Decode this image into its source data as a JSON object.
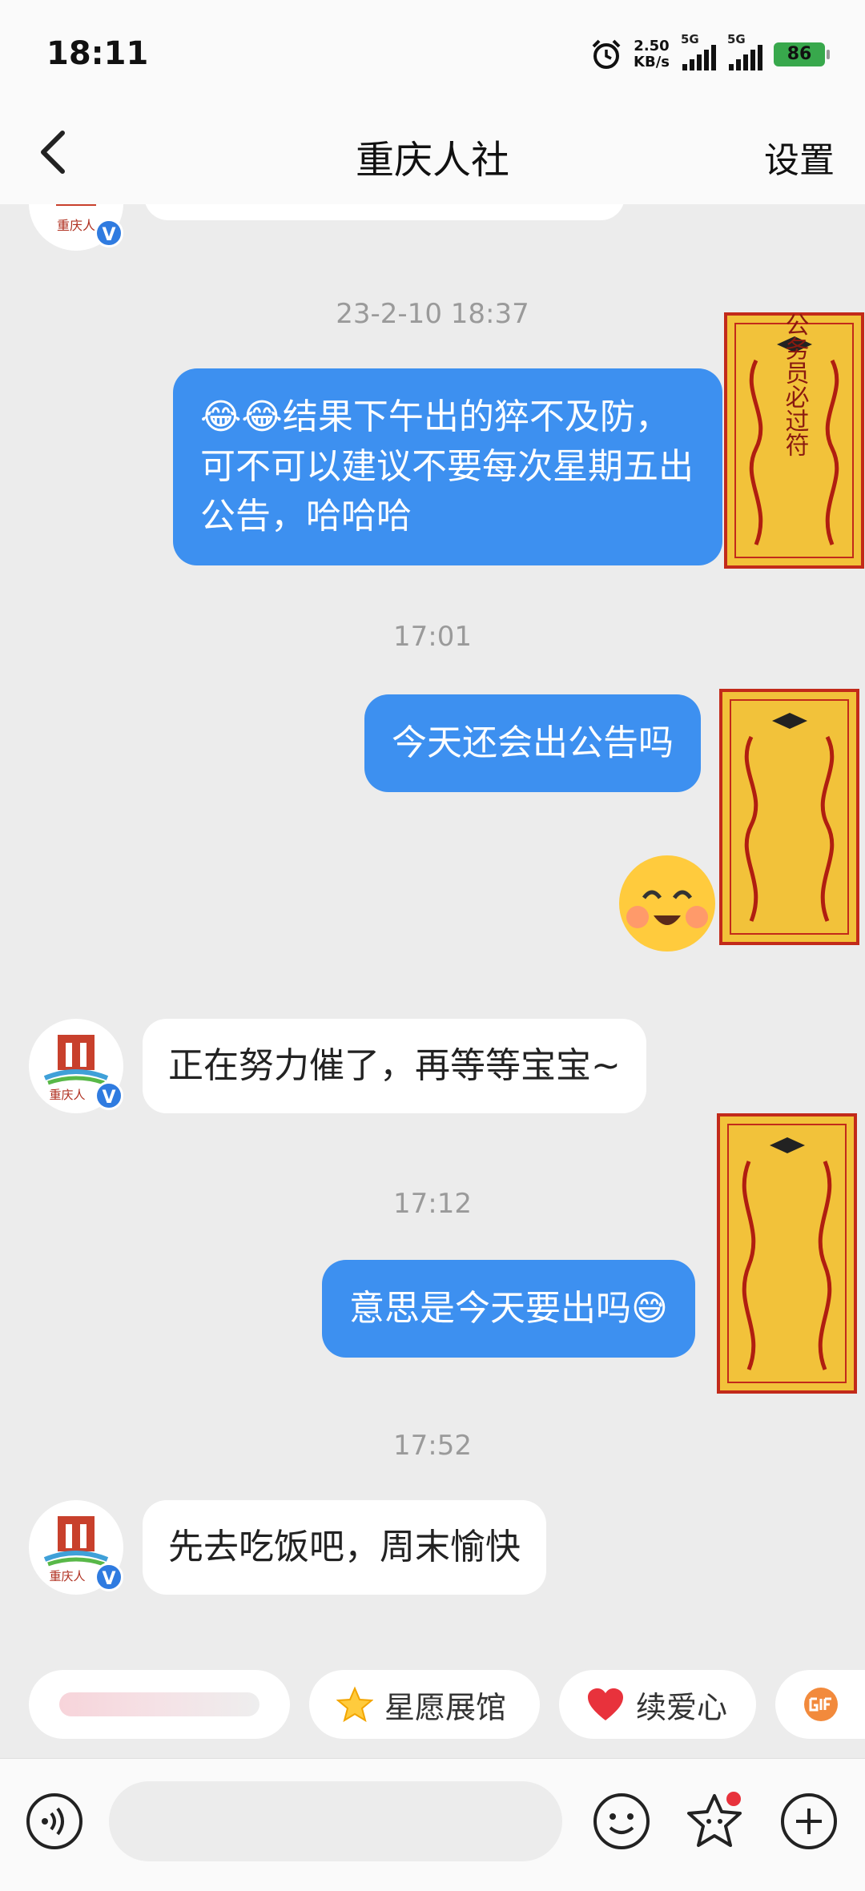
{
  "status_bar": {
    "time": "18:11",
    "net_speed": "2.50",
    "net_unit": "KB/s",
    "sim1": "5G",
    "sim2": "5G",
    "battery": "86"
  },
  "header": {
    "title": "重庆人社",
    "settings_label": "设置"
  },
  "avatar": {
    "name": "重庆人",
    "verified": "V"
  },
  "talisman_text": "公务员必过符",
  "messages": [
    {
      "type": "timestamp",
      "text": "23-2-10 18:37"
    },
    {
      "type": "sent",
      "text": "结果下午出的猝不及防，可不可以建议不要每次星期五出公告，哈哈哈",
      "emoji_prefix": "😂😂"
    },
    {
      "type": "timestamp",
      "text": "17:01"
    },
    {
      "type": "sent",
      "text": "今天还会出公告吗"
    },
    {
      "type": "received",
      "text": "正在努力催了，再等等宝宝~"
    },
    {
      "type": "timestamp",
      "text": "17:12"
    },
    {
      "type": "sent",
      "text": "意思是今天要出吗"
    },
    {
      "type": "timestamp",
      "text": "17:52"
    },
    {
      "type": "received",
      "text": "先去吃饭吧，周末愉快"
    }
  ],
  "quick_actions": [
    {
      "label": "",
      "icon": "blurred-item"
    },
    {
      "label": "星愿展馆",
      "icon": "star-icon"
    },
    {
      "label": "续爱心",
      "icon": "heart-icon"
    },
    {
      "label": "",
      "icon": "gif-icon"
    }
  ],
  "colors": {
    "sent_bubble": "#3d90f0",
    "received_bubble": "#ffffff",
    "background": "#ececec"
  }
}
